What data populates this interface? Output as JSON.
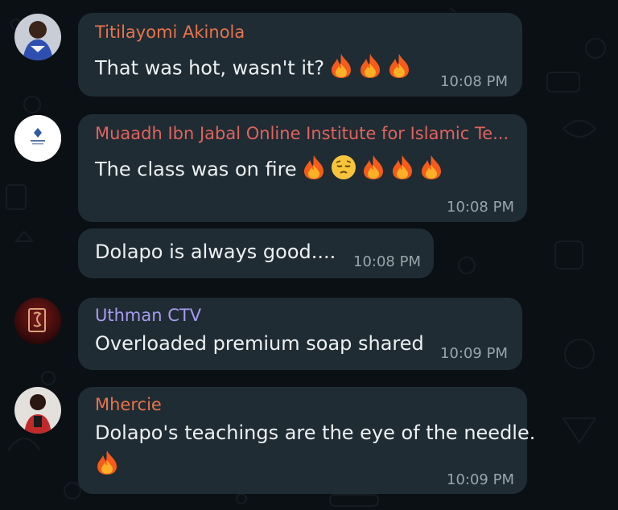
{
  "messages": [
    {
      "sender": "Titilayomi Akinola",
      "sender_color": "#e9734a",
      "text": "That was hot, wasn't it?",
      "emojis": [
        "fire-icon",
        "fire-icon",
        "fire-icon"
      ],
      "time": "10:08 PM"
    },
    {
      "sender": "Muaadh Ibn Jabal Online Institute for Islamic Te...",
      "sender_color": "#e3625c",
      "text": "The class was on fire",
      "emojis": [
        "fire-icon",
        "pensive-face-icon",
        "fire-icon",
        "fire-icon",
        "fire-icon"
      ],
      "time": "10:08 PM"
    },
    {
      "text": "Dolapo is always good....",
      "time": "10:08 PM"
    },
    {
      "sender": "Uthman CTV",
      "sender_color": "#a99bf0",
      "text": "Overloaded premium soap shared",
      "time": "10:09 PM"
    },
    {
      "sender": "Mhercie",
      "sender_color": "#e9734a",
      "text": "Dolapo's teachings are the eye of the needle.",
      "emojis": [
        "fire-icon"
      ],
      "time": "10:09 PM"
    }
  ],
  "colors": {
    "background": "#0b1014",
    "bubble": "#1f2c34",
    "timestamp": "#9aa5ab"
  }
}
